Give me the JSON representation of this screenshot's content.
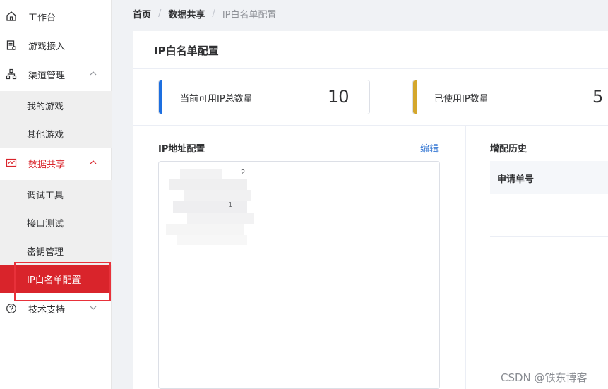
{
  "sidebar": {
    "items": [
      {
        "label": "工作台",
        "icon": "home-icon"
      },
      {
        "label": "游戏接入",
        "icon": "document-icon"
      },
      {
        "label": "渠道管理",
        "icon": "sitemap-icon"
      },
      {
        "label": "数据共享",
        "icon": "chart-icon"
      },
      {
        "label": "技术支持",
        "icon": "help-icon"
      }
    ],
    "channel_sub": [
      {
        "label": "我的游戏"
      },
      {
        "label": "其他游戏"
      }
    ],
    "data_sub": [
      {
        "label": "调试工具"
      },
      {
        "label": "接口测试"
      },
      {
        "label": "密钥管理"
      },
      {
        "label": "IP白名单配置"
      }
    ]
  },
  "breadcrumb": {
    "home": "首页",
    "section": "数据共享",
    "current": "IP白名单配置",
    "separator": "/"
  },
  "card": {
    "title": "IP白名单配置",
    "stats": [
      {
        "label": "当前可用IP总数量",
        "value": "10",
        "color": "#1d6fe0"
      },
      {
        "label": "已使用IP数量",
        "value": "5",
        "color": "#d4a72c"
      }
    ],
    "ip_section_title": "IP地址配置",
    "edit_label": "编辑",
    "ip_visible_text": [
      "2",
      "1"
    ],
    "history_title": "增配历史",
    "history_columns": [
      "申请单号"
    ]
  },
  "watermark": "CSDN @铁东博客",
  "colors": {
    "accent_red": "#d9242b",
    "link_blue": "#3a7bd5"
  }
}
